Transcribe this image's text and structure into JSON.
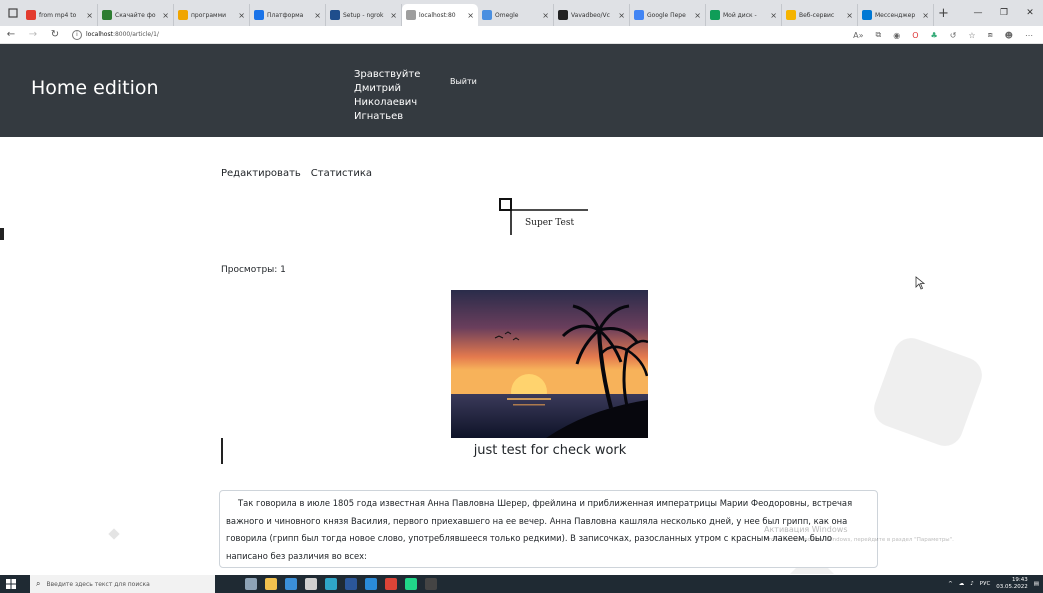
{
  "browser": {
    "tabs": [
      {
        "title": "from mp4 to",
        "favicon_color": "#e33b2e"
      },
      {
        "title": "Скачайте фо",
        "favicon_color": "#2e7d32"
      },
      {
        "title": "программи",
        "favicon_color": "#f0a500"
      },
      {
        "title": "Платформа",
        "favicon_color": "#1a73e8"
      },
      {
        "title": "Setup - ngrok",
        "favicon_color": "#1f4e8c"
      },
      {
        "title": "localhost:80",
        "favicon_color": "#9e9e9e",
        "active": true
      },
      {
        "title": "Omegle",
        "favicon_color": "#4a8fe0"
      },
      {
        "title": "Vavadbeo/Vc",
        "favicon_color": "#222222"
      },
      {
        "title": "Google Пере",
        "favicon_color": "#4285f4"
      },
      {
        "title": "Мой диск -",
        "favicon_color": "#0f9d58"
      },
      {
        "title": "Веб-сервис",
        "favicon_color": "#f5b400"
      },
      {
        "title": "Мессенджер",
        "favicon_color": "#0078d4"
      }
    ],
    "new_tab": "+",
    "url_host": "localhost",
    "url_path": ":8000/article/1/"
  },
  "site": {
    "brand": "Home edition",
    "greeting": "Зравствуйте Дмитрий Николаевич Игнатьев",
    "logout": "Выйти"
  },
  "article": {
    "actions": [
      "Редактировать",
      "Статистика"
    ],
    "image_alt": "Super Test",
    "views": "Просмотры: 1",
    "caption": "just test for check work",
    "body": "Так говорила в июле 1805 года известная Анна Павловна Шерер, фрейлина и приближенная императрицы Марии Феодоровны, встречая важного и чиновного князя Василия, первого приехавшего на ее вечер. Анна Павловна кашляла несколько дней, у нее был грипп, как она говорила (грипп был тогда новое слово, употреблявшееся только редкими). В записочках, разосланных утром с красным лакеем, было написано без различия во всех:"
  },
  "watermark": {
    "title": "Активация Windows",
    "subtitle": "Чтобы активировать Windows, перейдите в раздел \"Параметры\"."
  },
  "taskbar": {
    "search_placeholder": "Введите здесь текст для поиска",
    "lang": "РУС",
    "time": "19:43",
    "date": "03.05.2022"
  },
  "colors": {
    "header_bg": "#343a40",
    "taskbar_bg": "#1f2a33"
  }
}
